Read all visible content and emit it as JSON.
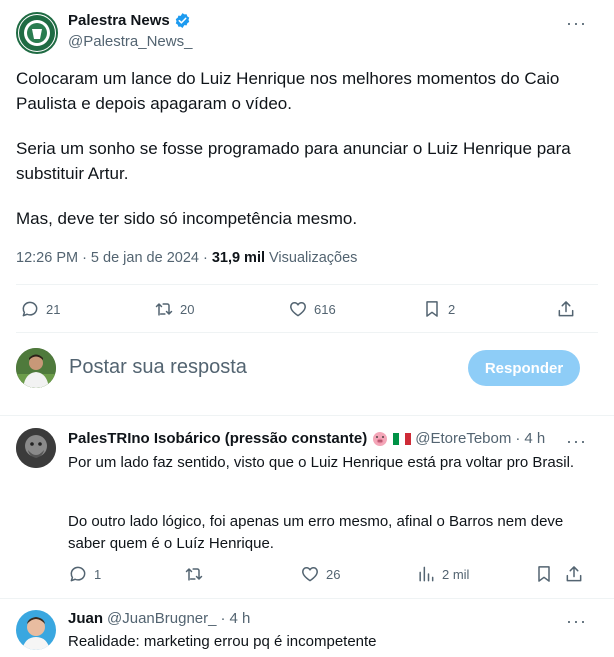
{
  "tweet": {
    "author_name": "Palestra News",
    "author_handle": "@Palestra_News_",
    "paragraphs": [
      "Colocaram um lance do Luiz Henrique nos melhores momentos do Caio Paulista e depois apagaram o vídeo.",
      "Seria um sonho se fosse programado para anunciar o Luiz Henrique para substituir Artur.",
      "Mas, deve ter sido só incompetência mesmo."
    ],
    "time": "12:26 PM",
    "separator": "·",
    "date": "5 de jan de 2024",
    "views_count": "31,9 mil",
    "views_label": "Visualizações",
    "actions": {
      "replies": "21",
      "retweets": "20",
      "likes": "616",
      "bookmarks": "2"
    }
  },
  "composer": {
    "placeholder": "Postar sua resposta",
    "button_label": "Responder"
  },
  "replies": [
    {
      "name": "PalesTRIno Isobárico (pressão constante)",
      "handle": "@EtoreTebom",
      "separator": "·",
      "time": "4 h",
      "text1": "Por um lado faz sentido, visto que o Luiz Henrique está pra voltar pro Brasil.",
      "text2": "Do outro lado lógico, foi apenas um erro mesmo, afinal o Barros nem deve saber quem é o Luíz Henrique.",
      "replies": "1",
      "retweets": "",
      "likes": "26",
      "views": "2 mil"
    },
    {
      "name": "Juan",
      "handle": "@JuanBrugner_",
      "separator": "·",
      "time": "4 h",
      "text1": "Realidade: marketing errou pq é incompetente"
    }
  ],
  "more_glyph": "···",
  "colors": {
    "accent": "#1d9bf0",
    "reply_button_disabled": "#8ecdf7",
    "muted_text": "#536471",
    "divider": "#eff3f4"
  }
}
